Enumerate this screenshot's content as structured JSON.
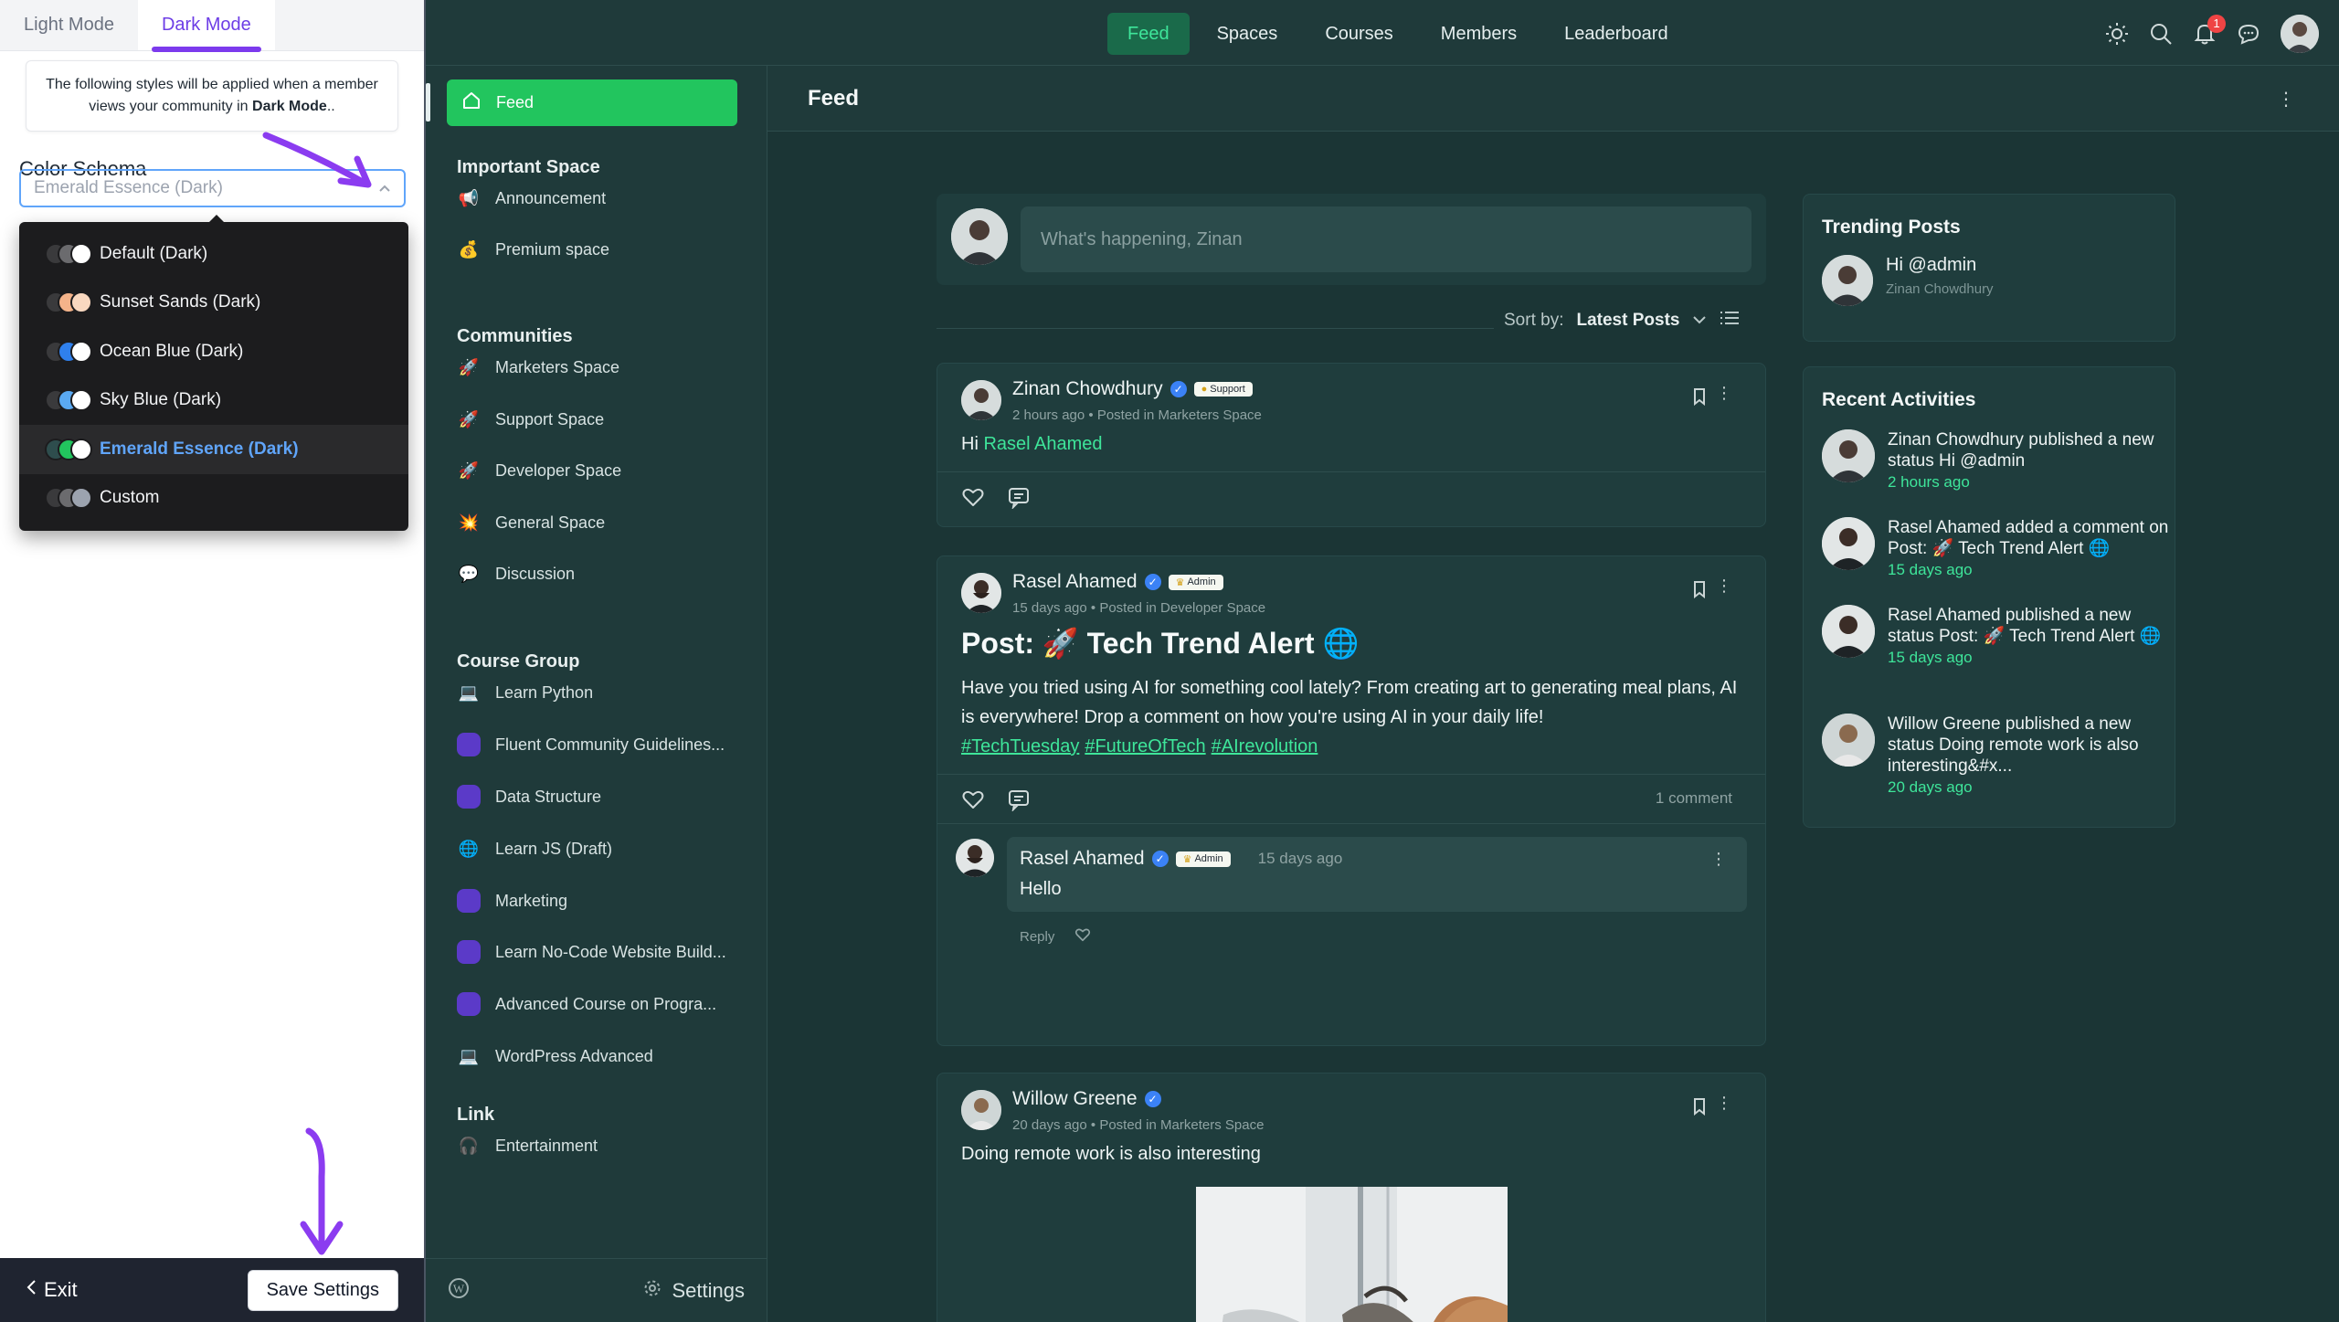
{
  "customizer": {
    "tabs": [
      {
        "label": "Light Mode",
        "active": false
      },
      {
        "label": "Dark Mode",
        "active": true
      }
    ],
    "note_prefix": "The following styles will be applied when a member views your community in",
    "note_bold": "Dark Mode",
    "note_suffix": "..",
    "color_schema_label": "Color Schema",
    "selected_value": "Emerald Essence (Dark)",
    "options": [
      {
        "label": "Default (Dark)",
        "colors": [
          "#3a3a3c",
          "#6b6b6e",
          "#ffffff"
        ],
        "selected": false
      },
      {
        "label": "Sunset Sands (Dark)",
        "colors": [
          "#3a3a3c",
          "#f4b38a",
          "#f9d8c0"
        ],
        "selected": false
      },
      {
        "label": "Ocean Blue (Dark)",
        "colors": [
          "#3a3a3c",
          "#2f80ed",
          "#ffffff"
        ],
        "selected": false
      },
      {
        "label": "Sky Blue (Dark)",
        "colors": [
          "#3a3a3c",
          "#5aa9f2",
          "#ffffff"
        ],
        "selected": false
      },
      {
        "label": "Emerald Essence (Dark)",
        "colors": [
          "#2e4d4d",
          "#22c55e",
          "#ffffff"
        ],
        "selected": true
      },
      {
        "label": "Custom",
        "colors": [
          "#3a3a3c",
          "#6b6b6e",
          "#9ca3af"
        ],
        "selected": false
      }
    ],
    "exit_label": "Exit",
    "save_label": "Save Settings"
  },
  "topnav": {
    "items": [
      {
        "label": "Feed",
        "active": true
      },
      {
        "label": "Spaces",
        "active": false
      },
      {
        "label": "Courses",
        "active": false
      },
      {
        "label": "Members",
        "active": false
      },
      {
        "label": "Leaderboard",
        "active": false
      }
    ],
    "notification_count": "1"
  },
  "sidebar": {
    "feed_label": "Feed",
    "groups": [
      {
        "title": "Important Space",
        "items": [
          {
            "label": "Announcement",
            "icon": "megaphone-icon",
            "glyph": "📢"
          },
          {
            "label": "Premium space",
            "icon": "money-bag-icon",
            "glyph": "💰"
          }
        ]
      },
      {
        "title": "Communities",
        "items": [
          {
            "label": "Marketers Space",
            "icon": "rocket-icon",
            "glyph": "🚀"
          },
          {
            "label": "Support Space",
            "icon": "rocket-icon",
            "glyph": "🚀"
          },
          {
            "label": "Developer Space",
            "icon": "rocket-icon",
            "glyph": "🚀"
          },
          {
            "label": "General Space",
            "icon": "spark-icon",
            "glyph": "💥"
          },
          {
            "label": "Discussion",
            "icon": "speech-bubble-icon",
            "glyph": "💬"
          }
        ]
      },
      {
        "title": "Course Group",
        "items": [
          {
            "label": "Learn Python",
            "icon": "laptop-icon",
            "glyph": "💻"
          },
          {
            "label": "Fluent Community Guidelines...",
            "icon": "course-icon",
            "glyph": ""
          },
          {
            "label": "Data Structure",
            "icon": "course-icon",
            "glyph": ""
          },
          {
            "label": "Learn JS (Draft)",
            "icon": "globe-icon",
            "glyph": "🌐"
          },
          {
            "label": "Marketing",
            "icon": "course-icon",
            "glyph": ""
          },
          {
            "label": "Learn No-Code Website Build...",
            "icon": "course-icon",
            "glyph": ""
          },
          {
            "label": "Advanced Course on Progra...",
            "icon": "course-icon",
            "glyph": ""
          },
          {
            "label": "WordPress Advanced",
            "icon": "laptop-icon",
            "glyph": "💻"
          }
        ]
      },
      {
        "title": "Link",
        "items": [
          {
            "label": "Entertainment",
            "icon": "headphones-icon",
            "glyph": "🎧"
          }
        ]
      }
    ],
    "settings_label": "Settings"
  },
  "main": {
    "title": "Feed",
    "composer_placeholder": "What's happening, Zinan",
    "sort_label": "Sort by:",
    "sort_value": "Latest Posts",
    "posts": [
      {
        "author": "Zinan Chowdhury",
        "role": "Support",
        "meta": "2 hours ago • Posted in Marketers Space",
        "text_prefix": "Hi",
        "mention": "Rasel Ahamed"
      },
      {
        "author": "Rasel Ahamed",
        "role": "Admin",
        "meta": "15 days ago • Posted in Developer Space",
        "title": "Post: 🚀 Tech Trend Alert 🌐",
        "text": "Have you tried using AI for something cool lately? From creating art to generating meal plans, AI is everywhere! Drop a comment on how you're using AI in your daily life!",
        "tags": [
          "#TechTuesday",
          "#FutureOfTech",
          "#AIrevolution"
        ],
        "comment_count": "1 comment",
        "comment": {
          "author": "Rasel Ahamed",
          "role": "Admin",
          "time": "15 days ago",
          "text": "Hello",
          "reply_label": "Reply"
        }
      },
      {
        "author": "Willow Greene",
        "meta": "20 days ago • Posted in Marketers Space",
        "text": "Doing remote work is also interesting"
      }
    ]
  },
  "trending": {
    "title": "Trending Posts",
    "items": [
      {
        "title": "Hi @admin",
        "author": "Zinan Chowdhury"
      }
    ]
  },
  "activities": {
    "title": "Recent Activities",
    "items": [
      {
        "text": "Zinan Chowdhury published a new status Hi @admin",
        "time": "2 hours ago"
      },
      {
        "text": "Rasel Ahamed added a comment on Post: 🚀 Tech Trend Alert 🌐",
        "time": "15 days ago"
      },
      {
        "text": "Rasel Ahamed published a new status Post: 🚀 Tech Trend Alert 🌐",
        "time": "15 days ago"
      },
      {
        "text": "Willow Greene published a new status Doing remote work is also interesting&#x...",
        "time": "20 days ago"
      }
    ]
  },
  "colors": {
    "accent": "#22c55e",
    "accent_text": "#3ee59a",
    "background": "#1f3a3a",
    "customizer_accent": "#7c3aed"
  }
}
